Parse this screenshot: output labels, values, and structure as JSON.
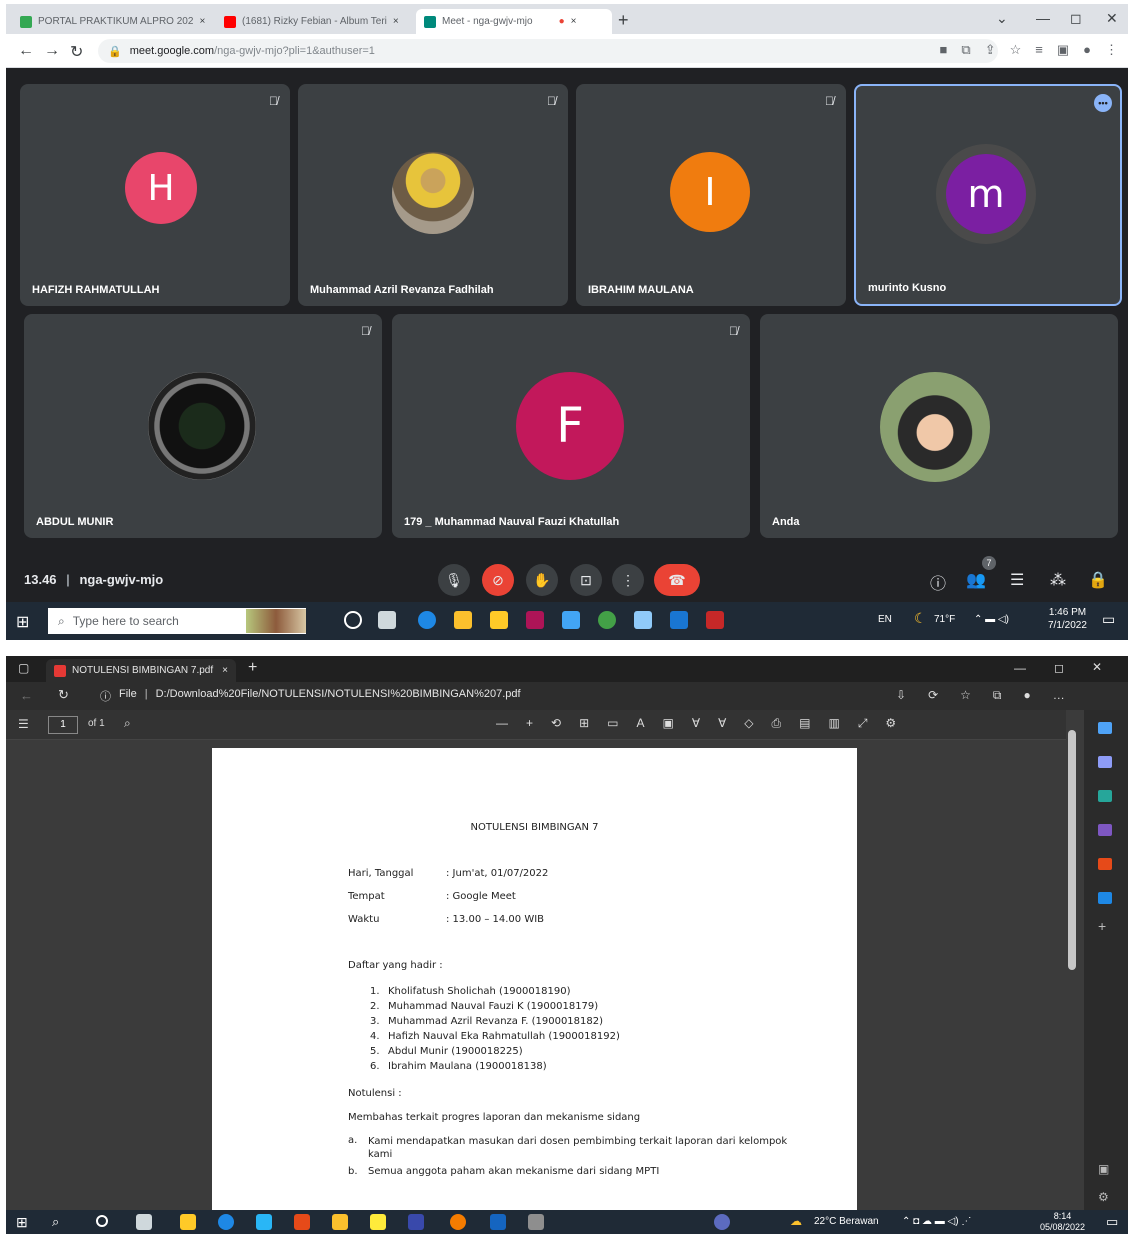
{
  "meet": {
    "tabs": [
      {
        "label": "PORTAL PRAKTIKUM ALPRO 202",
        "color": "#34a853"
      },
      {
        "label": "(1681) Rizky Febian - Album Teri",
        "color": "#ff0000"
      },
      {
        "label": "Meet - nga-gwjv-mjo",
        "color": "#00897b"
      }
    ],
    "url_host": "meet.google.com",
    "url_path": "/nga-gwjv-mjo?pli=1&authuser=1",
    "participants": [
      {
        "name": "HAFIZH RAHMATULLAH",
        "initial": "H",
        "color": "#e8466b"
      },
      {
        "name": "Muhammad Azril Revanza Fadhilah"
      },
      {
        "name": "IBRAHIM MAULANA",
        "initial": "I",
        "color": "#f07c0f"
      },
      {
        "name": "murinto Kusno",
        "initial": "m",
        "color": "#7b1fa2"
      },
      {
        "name": "ABDUL MUNIR"
      },
      {
        "name": "179 _ Muhammad Nauval Fauzi Khatullah",
        "initial": "F",
        "color": "#c2185b"
      },
      {
        "name": "Anda"
      }
    ],
    "time": "13.46",
    "meeting_code": "nga-gwjv-mjo",
    "people_count": "7",
    "taskbar": {
      "search_placeholder": "Type here to search",
      "lang": "EN",
      "temp": "71°F",
      "clock_time": "1:46 PM",
      "clock_date": "7/1/2022"
    }
  },
  "pdf": {
    "tab_label": "NOTULENSI BIMBINGAN 7.pdf",
    "file_label": "File",
    "url": "D:/Download%20File/NOTULENSI/NOTULENSI%20BIMBINGAN%207.pdf",
    "page_current": "1",
    "page_total": "of 1",
    "title": "NOTULENSI BIMBINGAN 7",
    "fields": [
      {
        "label": "Hari, Tanggal",
        "value": ": Jum'at, 01/07/2022"
      },
      {
        "label": "Tempat",
        "value": ": Google Meet"
      },
      {
        "label": "Waktu",
        "value": ": 13.00 – 14.00 WIB"
      }
    ],
    "attendance_heading": "Daftar yang hadir :",
    "attendance": [
      "Kholifatush Sholichah (1900018190)",
      "Muhammad Nauval Fauzi K (1900018179)",
      "Muhammad Azril Revanza F. (1900018182)",
      "Hafizh Nauval Eka Rahmatullah (1900018192)",
      "Abdul Munir (1900018225)",
      "Ibrahim Maulana (1900018138)"
    ],
    "notes_heading": "Notulensi :",
    "notes_intro": "Membahas terkait progres laporan dan mekanisme sidang",
    "notes": [
      {
        "marker": "a.",
        "text": "Kami mendapatkan masukan dari dosen pembimbing terkait laporan dari kelompok kami"
      },
      {
        "marker": "b.",
        "text": "Semua anggota paham akan mekanisme dari sidang MPTI"
      }
    ],
    "taskbar": {
      "weather": "22°C Berawan",
      "clock_time": "8:14",
      "clock_date": "05/08/2022"
    }
  }
}
